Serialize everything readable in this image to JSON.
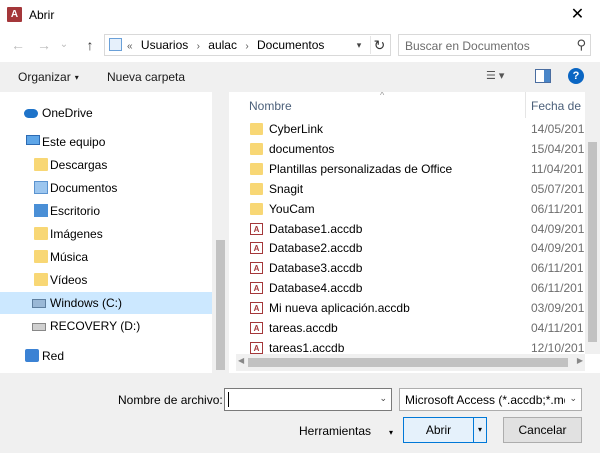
{
  "window": {
    "title": "Abrir",
    "app_icon": "A",
    "close_glyph": "✕"
  },
  "nav": {
    "back": "←",
    "forward": "→",
    "recent": "⌄",
    "up": "↑"
  },
  "address": {
    "overflow": "«",
    "crumbs": [
      "Usuarios",
      "aulac",
      "Documentos"
    ],
    "separator": "›",
    "dropdown": "▾",
    "refresh": "↻"
  },
  "search": {
    "placeholder": "Buscar en Documentos",
    "icon": "⚲"
  },
  "toolbar": {
    "organize_label": "Organizar",
    "new_folder_label": "Nueva carpeta",
    "caret": "▾",
    "view_icon_glyph": "☰ ▾",
    "help_glyph": "?"
  },
  "sidebar": {
    "items": [
      {
        "label": "OneDrive",
        "icon": "onedrive-icon"
      },
      {
        "label": "Este equipo",
        "icon": "computer-icon"
      },
      {
        "label": "Descargas",
        "icon": "downloads-folder-icon"
      },
      {
        "label": "Documentos",
        "icon": "documents-folder-icon"
      },
      {
        "label": "Escritorio",
        "icon": "desktop-folder-icon"
      },
      {
        "label": "Imágenes",
        "icon": "pictures-folder-icon"
      },
      {
        "label": "Música",
        "icon": "music-folder-icon"
      },
      {
        "label": "Vídeos",
        "icon": "videos-folder-icon"
      },
      {
        "label": "Windows (C:)",
        "icon": "drive-icon",
        "selected": true
      },
      {
        "label": "RECOVERY (D:)",
        "icon": "drive-icon"
      },
      {
        "label": "Red",
        "icon": "network-icon"
      }
    ]
  },
  "list": {
    "header_name": "Nombre",
    "header_date": "Fecha de m",
    "sort_glyph": "^",
    "files": [
      {
        "name": "CyberLink",
        "date": "14/05/201",
        "type": "folder"
      },
      {
        "name": "documentos",
        "date": "15/04/201",
        "type": "folder"
      },
      {
        "name": "Plantillas personalizadas de Office",
        "date": "11/04/201",
        "type": "folder"
      },
      {
        "name": "Snagit",
        "date": "05/07/201",
        "type": "folder"
      },
      {
        "name": "YouCam",
        "date": "06/11/201",
        "type": "folder"
      },
      {
        "name": "Database1.accdb",
        "date": "04/09/201",
        "type": "accdb"
      },
      {
        "name": "Database2.accdb",
        "date": "04/09/201",
        "type": "accdb"
      },
      {
        "name": "Database3.accdb",
        "date": "06/11/201",
        "type": "accdb"
      },
      {
        "name": "Database4.accdb",
        "date": "06/11/201",
        "type": "accdb"
      },
      {
        "name": "Mi nueva aplicación.accdb",
        "date": "03/09/201",
        "type": "accdb"
      },
      {
        "name": "tareas.accdb",
        "date": "04/11/201",
        "type": "accdb"
      },
      {
        "name": "tareas1.accdb",
        "date": "12/10/201",
        "type": "accdb"
      }
    ]
  },
  "footer": {
    "filename_label": "Nombre de archivo:",
    "filename_value": "",
    "filter_value": "Microsoft Access (*.accdb;*.mdl",
    "tools_label": "Herramientas",
    "open_label": "Abrir",
    "cancel_label": "Cancelar",
    "dropdown": "⌄",
    "split_glyph": "▾"
  },
  "colors": {
    "accent": "#0078d7",
    "selection": "#cce8ff",
    "folder": "#f8d775",
    "access": "#a4373a"
  }
}
